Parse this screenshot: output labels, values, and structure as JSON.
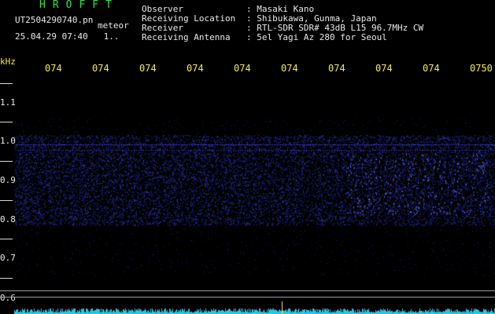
{
  "header": {
    "logo": "HROFFT",
    "filename": "UT2504290740.pn",
    "tag": "meteor",
    "datetime": "25.04.29 07:40   1..",
    "observer_label": "Observer",
    "observer_value": ": Masaki Kano",
    "location_label": "Receiving Location",
    "location_value": ": Shibukawa, Gunma, Japan",
    "receiver_label": "Receiver",
    "receiver_value": ": RTL-SDR SDR# 43dB L15 96.7MHz CW",
    "antenna_label": "Receiving Antenna",
    "antenna_value": ": 5el Yagi Az 280 for Seoul"
  },
  "axis": {
    "unit": "kHz",
    "time_ticks": [
      "074",
      "074",
      "074",
      "074",
      "074",
      "074",
      "074",
      "074",
      "074",
      "0750"
    ],
    "freq_ticks": [
      "1.1",
      "1.0",
      "0.9",
      "0.8",
      "0.7",
      "0.6"
    ]
  },
  "colors": {
    "background": "#000000",
    "header_green": "#33e04a",
    "tick_yellow": "#f2e94a",
    "signal_blue": "#3a4cff",
    "baseline_cyan": "#22c8e6"
  }
}
